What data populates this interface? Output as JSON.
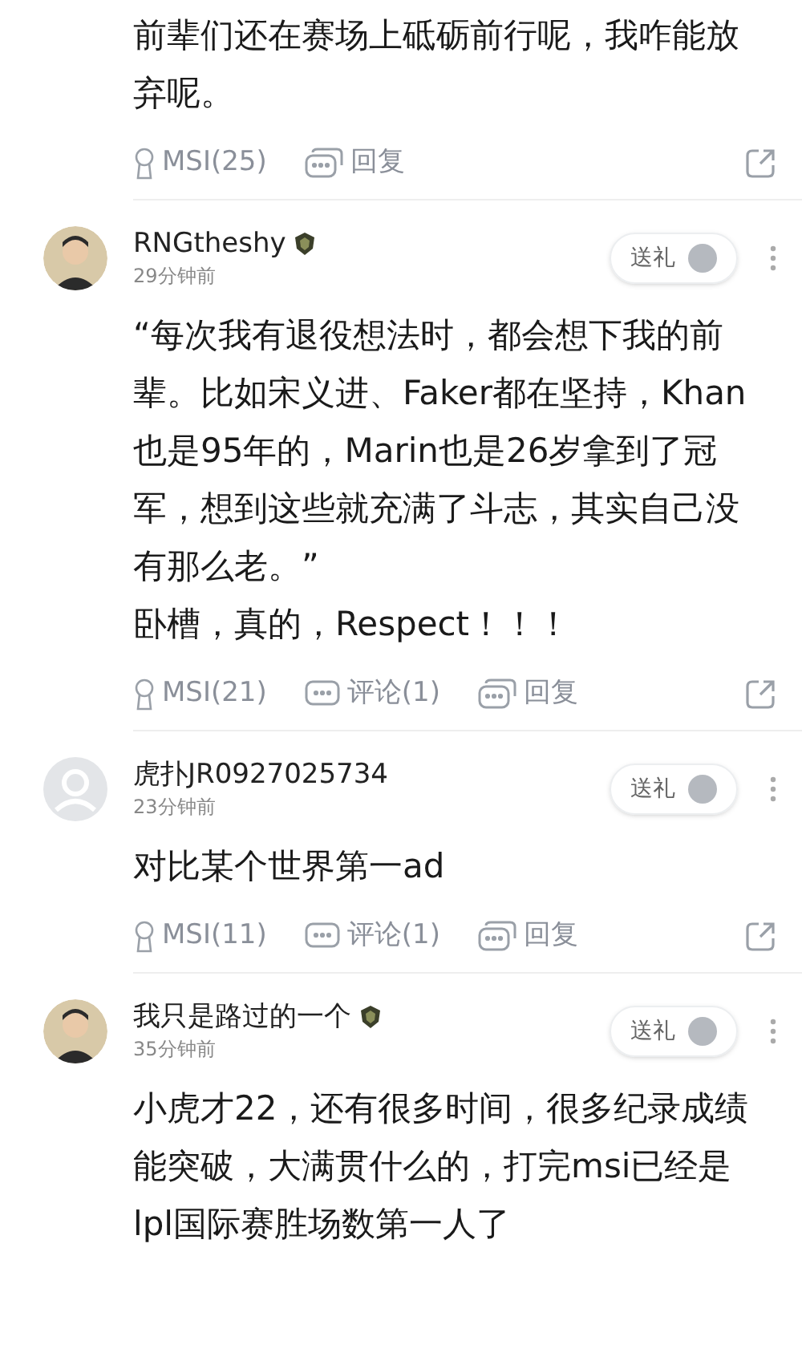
{
  "comments": [
    {
      "body": "前辈们还在赛场上砥砺前行呢，我咋能放弃呢。",
      "actions": {
        "msi": "MSI(25)",
        "reply": "回复"
      }
    },
    {
      "author": {
        "name": "RNGtheshy",
        "badge": true
      },
      "time": "29分钟前",
      "gift": "送礼",
      "body": "“每次我有退役想法时，都会想下我的前辈。比如宋义进、Faker都在坚持，Khan也是95年的，Marin也是26岁拿到了冠军，想到这些就充满了斗志，其实自己没有那么老。”\n卧槽，真的，Respect！！！",
      "actions": {
        "msi": "MSI(21)",
        "comments": "评论(1)",
        "reply": "回复"
      }
    },
    {
      "author": {
        "name": "虎扑JR0927025734",
        "badge": false,
        "avatar": {
          "kind": "default"
        }
      },
      "time": "23分钟前",
      "gift": "送礼",
      "body": "对比某个世界第一ad",
      "actions": {
        "msi": "MSI(11)",
        "comments": "评论(1)",
        "reply": "回复"
      }
    },
    {
      "author": {
        "name": "我只是路过的一个",
        "badge": true
      },
      "time": "35分钟前",
      "gift": "送礼",
      "body": "小虎才22，还有很多时间，很多纪录成绩能突破，大满贯什么的，打完msi已经是lpl国际赛胜场数第一人了"
    }
  ]
}
